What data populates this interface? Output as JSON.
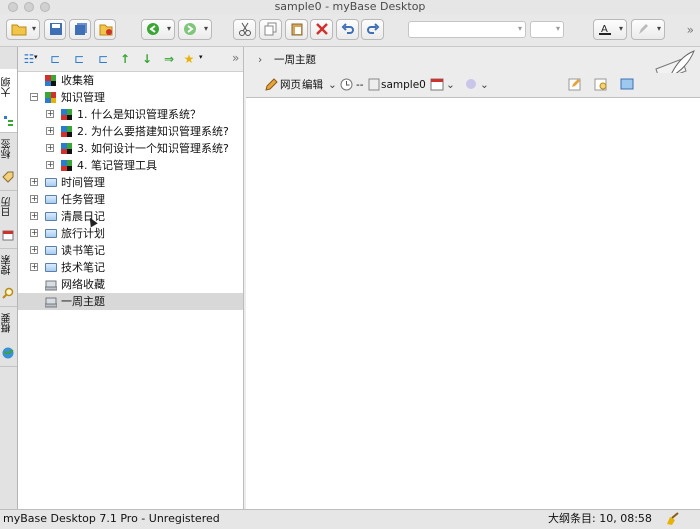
{
  "window": {
    "title": "sample0 - myBase Desktop"
  },
  "side_tabs": [
    "大纲",
    "标签",
    "日历",
    "搜索",
    "概要"
  ],
  "tree": [
    {
      "label": "收集箱",
      "level": 0,
      "expander": "",
      "icon": "inbox-icon"
    },
    {
      "label": "知识管理",
      "level": 0,
      "expander": "−",
      "icon": "book-icon"
    },
    {
      "label": "1. 什么是知识管理系统？",
      "level": 1,
      "expander": "+",
      "icon": "colorful-note-icon"
    },
    {
      "label": "2. 为什么要搭建知识管理系统?",
      "level": 1,
      "expander": "+",
      "icon": "colorful-note-icon"
    },
    {
      "label": "3. 如何设计一个知识管理系统?",
      "level": 1,
      "expander": "+",
      "icon": "colorful-note-icon"
    },
    {
      "label": "4. 笔记管理工具",
      "level": 1,
      "expander": "+",
      "icon": "colorful-note-icon"
    },
    {
      "label": "时间管理",
      "level": 0,
      "expander": "+",
      "icon": "folder-icon"
    },
    {
      "label": "任务管理",
      "level": 0,
      "expander": "+",
      "icon": "folder-icon"
    },
    {
      "label": "清晨日记",
      "level": 0,
      "expander": "+",
      "icon": "folder-icon"
    },
    {
      "label": "旅行计划",
      "level": 0,
      "expander": "+",
      "icon": "folder-icon"
    },
    {
      "label": "读书笔记",
      "level": 0,
      "expander": "+",
      "icon": "folder-icon"
    },
    {
      "label": "技术笔记",
      "level": 0,
      "expander": "+",
      "icon": "folder-icon"
    },
    {
      "label": "网络收藏",
      "level": 0,
      "expander": "",
      "icon": "web-drive-icon"
    },
    {
      "label": "一周主题",
      "level": 0,
      "expander": "",
      "icon": "web-drive-icon",
      "selected": true
    }
  ],
  "right": {
    "breadcrumb": "一周主题",
    "view_mode": "网页",
    "edit_label": "编辑",
    "rating": "--",
    "db_name": "sample0"
  },
  "status": {
    "left": "myBase Desktop 7.1 Pro - Unregistered",
    "right": "大纲条目: 10, 08:58"
  },
  "colors": {
    "accent_green": "#3aa635",
    "delete_red": "#d0312d",
    "selected_row": "#d8d8d8"
  }
}
